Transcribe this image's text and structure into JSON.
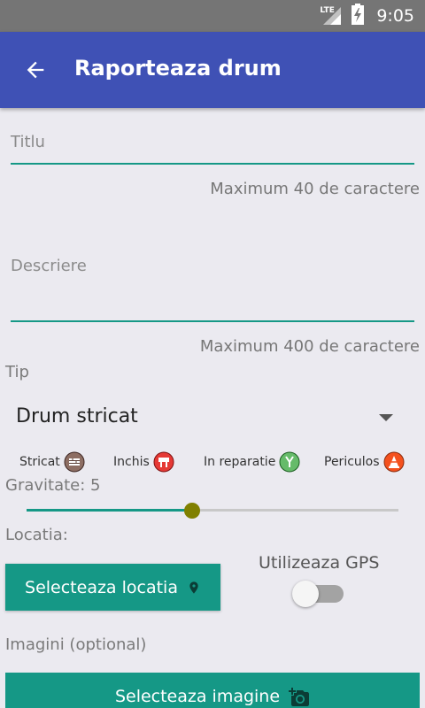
{
  "status_bar": {
    "network": "LTE",
    "time": "9:05",
    "icons": [
      "signal-icon",
      "battery-charging-icon"
    ]
  },
  "app_bar": {
    "title": "Raporteaza drum",
    "back_icon": "arrow-back-icon"
  },
  "form": {
    "title_placeholder": "Titlu",
    "title_hint": "Maximum 40 de caractere",
    "description_placeholder": "Descriere",
    "description_hint": "Maximum 400 de caractere",
    "type_label": "Tip",
    "type_selected": "Drum stricat",
    "types": [
      {
        "label": "Stricat",
        "icon": "broken-road-icon",
        "color": "#8D6E63"
      },
      {
        "label": "Inchis",
        "icon": "road-closed-icon",
        "color": "#E53935"
      },
      {
        "label": "In reparatie",
        "icon": "road-repair-icon",
        "color": "#66BB6A"
      },
      {
        "label": "Periculos",
        "icon": "danger-cone-icon",
        "color": "#F4511E"
      }
    ],
    "severity_label": "Gravitate: 5",
    "severity": {
      "value": 5,
      "min": 1,
      "max": 10
    },
    "location_label": "Locatia:",
    "select_location_button": "Selecteaza locatia",
    "use_gps_label": "Utilizeaza GPS",
    "use_gps_enabled": false,
    "images_label": "Imagini (optional)",
    "select_image_button": "Selecteaza imagine"
  },
  "colors": {
    "primary": "#3F51B5",
    "accent": "#159886",
    "status_bar": "#757575",
    "background": "#EBEAF0",
    "slider_thumb": "#808000"
  }
}
